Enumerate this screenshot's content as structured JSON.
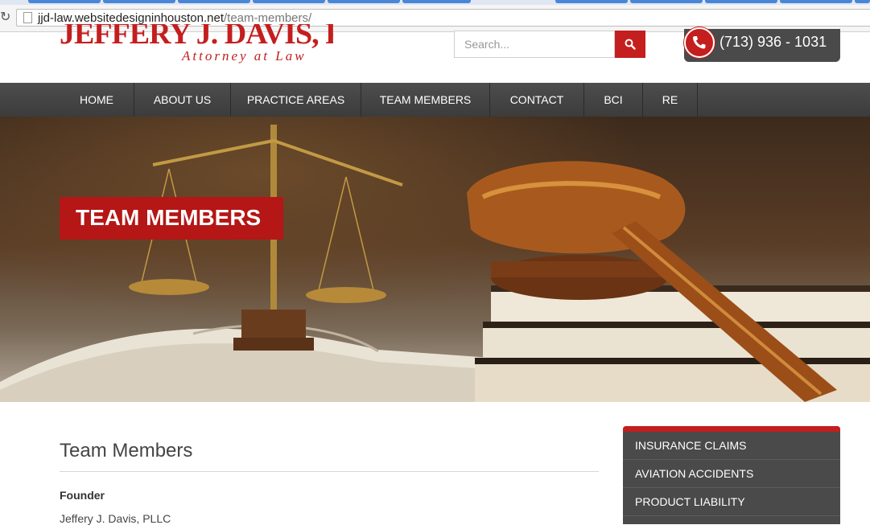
{
  "browser": {
    "url_domain": "jjd-law.websitedesigninhouston.net",
    "url_path": "/team-members/"
  },
  "header": {
    "logo_name": "JEFFERY J. DAVIS, PLLC",
    "logo_tagline": "Attorney at Law",
    "search_placeholder": "Search...",
    "phone": "(713) 936 - 1031"
  },
  "nav": {
    "items": [
      {
        "label": "HOME"
      },
      {
        "label": "ABOUT US"
      },
      {
        "label": "PRACTICE AREAS"
      },
      {
        "label": "TEAM MEMBERS"
      },
      {
        "label": "CONTACT"
      },
      {
        "label": "BCI"
      },
      {
        "label": "RE"
      }
    ]
  },
  "hero": {
    "title": "TEAM MEMBERS"
  },
  "main": {
    "title": "Team Members",
    "founder_label": "Founder",
    "founder_value": "Jeffery J. Davis, PLLC"
  },
  "sidebar": {
    "items": [
      {
        "label": "INSURANCE CLAIMS"
      },
      {
        "label": "AVIATION ACCIDENTS"
      },
      {
        "label": "PRODUCT LIABILITY"
      }
    ]
  },
  "colors": {
    "brand_red": "#c41e1e",
    "nav_dark": "#444444"
  }
}
